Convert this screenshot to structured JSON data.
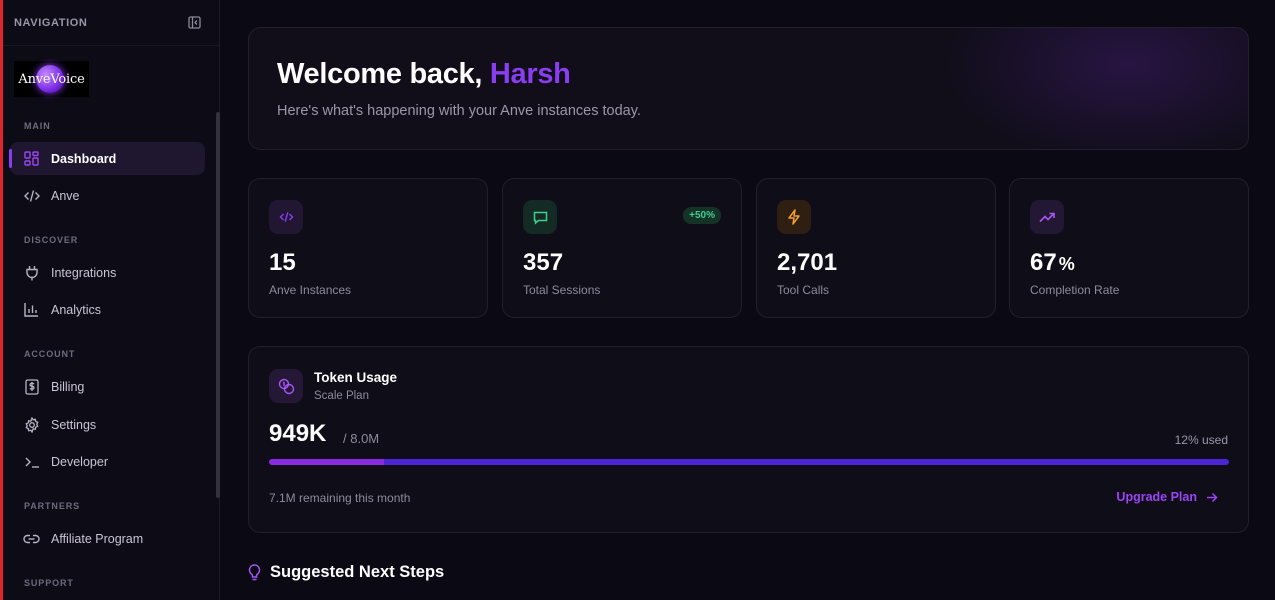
{
  "sidebar": {
    "title": "NAVIGATION",
    "logo_text": "AnveVoice",
    "sections": {
      "main": "MAIN",
      "discover": "DISCOVER",
      "account": "ACCOUNT",
      "partners": "PARTNERS",
      "support": "SUPPORT"
    },
    "items": {
      "dashboard": "Dashboard",
      "anve": "Anve",
      "integrations": "Integrations",
      "analytics": "Analytics",
      "billing": "Billing",
      "settings": "Settings",
      "developer": "Developer",
      "affiliate": "Affiliate Program"
    },
    "active_item": "dashboard"
  },
  "hero": {
    "greeting": "Welcome back,",
    "name": "Harsh",
    "subtitle": "Here's what's happening with your Anve instances today."
  },
  "stats": [
    {
      "value": "15",
      "label": "Anve Instances",
      "icon": "code-icon",
      "color": "#8b3df2"
    },
    {
      "value": "357",
      "label": "Total Sessions",
      "icon": "message-square-icon",
      "color": "#3fcf8e",
      "chip": "+50%"
    },
    {
      "value": "2,701",
      "label": "Tool Calls",
      "icon": "lightning-icon",
      "color": "#f59e2a"
    },
    {
      "value": "67",
      "suffix": "%",
      "label": "Completion Rate",
      "icon": "trending-up-icon",
      "color": "#a855f7"
    }
  ],
  "token_usage": {
    "title": "Token Usage",
    "plan": "Scale Plan",
    "used": "949K",
    "total": "/ 8.0M",
    "percent_label": "12% used",
    "percent": 0.12,
    "remaining": "7.1M remaining this month",
    "upgrade_label": "Upgrade Plan"
  },
  "next_steps": {
    "title": "Suggested Next Steps"
  },
  "colors": {
    "accent": "#8b3df2",
    "bar_track": "#4c26d6",
    "bar_fill": "#8a2be2",
    "edge": "#e0242d"
  }
}
